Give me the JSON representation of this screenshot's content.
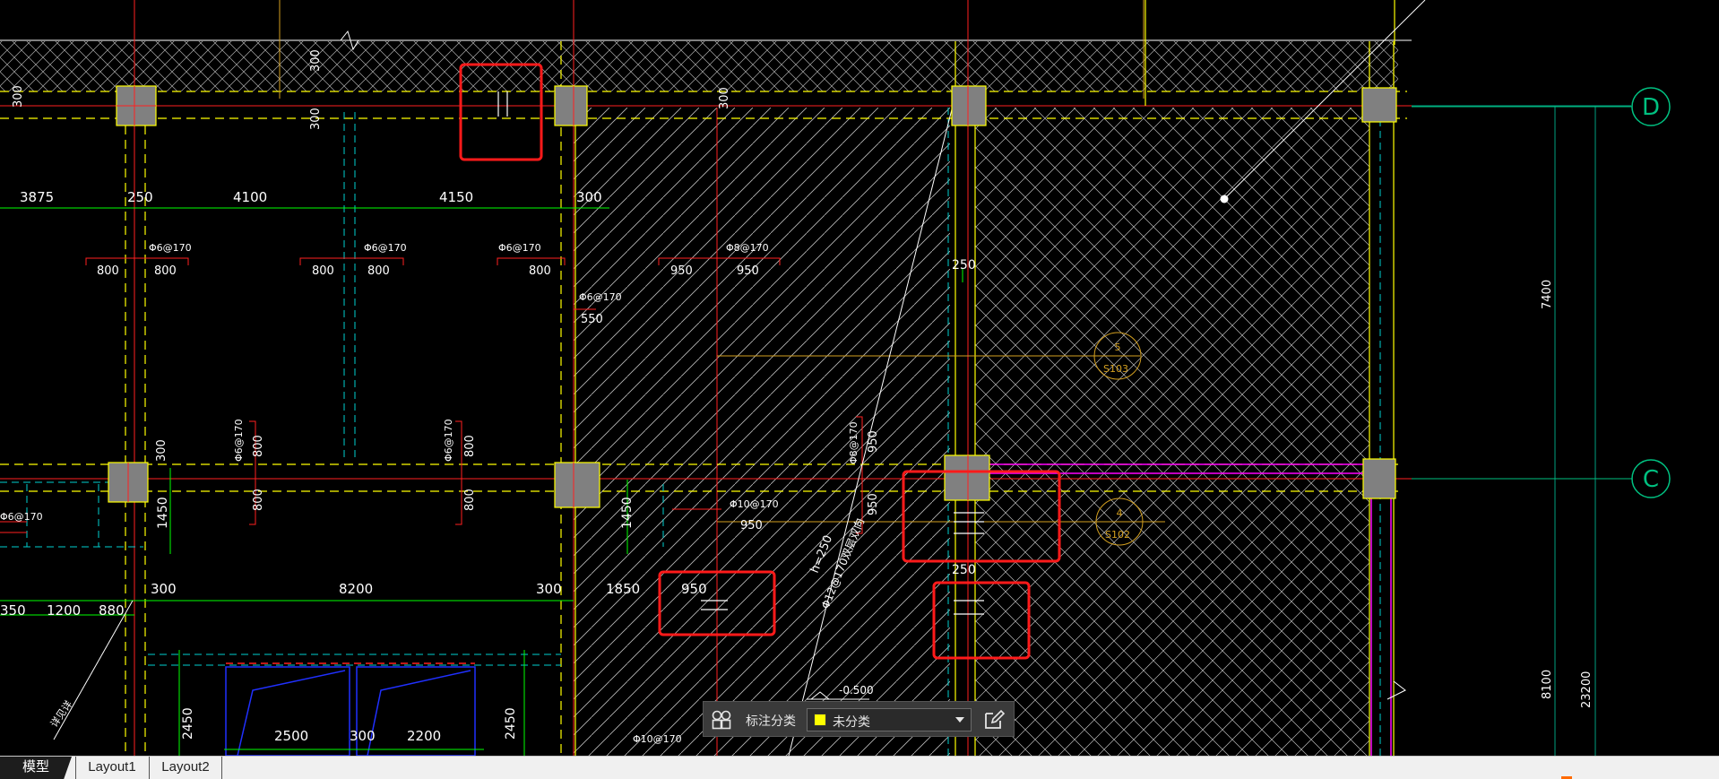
{
  "cad": {
    "dims": {
      "d3875": "3875",
      "d250a": "250",
      "d4100": "4100",
      "d4150": "4150",
      "d300a": "300",
      "d300b": "300",
      "d300c": "300",
      "d300d": "300",
      "d300e": "300",
      "d300f": "300",
      "d250b": "250",
      "d250c": "250",
      "d800a": "800",
      "d800b": "800",
      "d800c": "800",
      "d800d": "800",
      "d800e": "800",
      "d950a": "950",
      "d950b": "950",
      "d550": "550",
      "d800v1": "800",
      "d800v2": "800",
      "d800v3": "800",
      "d800v4": "800",
      "d950v1": "950",
      "d950v2": "950",
      "d950c": "950",
      "d950box": "950",
      "d1450a": "1450",
      "d1450b": "1450",
      "d300g": "300",
      "d8200": "8200",
      "d300h": "300",
      "d1850": "1850",
      "d350": "350",
      "d1200": "1200",
      "d880": "880",
      "d2450a": "2450",
      "d2500": "2500",
      "d300i": "300",
      "d2200": "2200",
      "d2450b": "2450",
      "d7400": "7400",
      "d8100": "8100",
      "d23200": "23200",
      "elev": "-0.500"
    },
    "rebar": {
      "r1": "Φ6@170",
      "r2": "Φ6@170",
      "r3": "Φ6@170",
      "r4": "Φ8@170",
      "r5": "Φ6@170",
      "r6": "Φ6@170",
      "r7": "Φ6@170",
      "r8": "Φ8@170",
      "r9": "Φ10@170",
      "r10": "Φ6@170",
      "r11": "Φ10@170"
    },
    "notes": {
      "slab_h": "h=250",
      "slab_bar": "Φ12@170双层双向",
      "leftnote": "详见详"
    },
    "axes": {
      "d": "D",
      "c": "C"
    },
    "tags": {
      "t5num": "5",
      "t5ref": "S103",
      "t4num": "4",
      "t4ref": "S102"
    }
  },
  "toolbar": {
    "grid_icon": "grid-icon",
    "label": "标注分类",
    "select_value": "未分类",
    "swatch_color": "#ffff00",
    "edit_icon": "edit-icon"
  },
  "tabs": {
    "model": "模型",
    "layout1": "Layout1",
    "layout2": "Layout2"
  },
  "colors": {
    "background": "#000000",
    "red": "#ff2020",
    "yellow": "#ffff00",
    "green": "#00ff00",
    "cyan": "#00d0d0",
    "white": "#ffffff",
    "orange": "#d4a020",
    "magenta": "#ff00ff",
    "blue": "#2030ff",
    "column": "#808080",
    "highlight": "#ff1a1a"
  }
}
